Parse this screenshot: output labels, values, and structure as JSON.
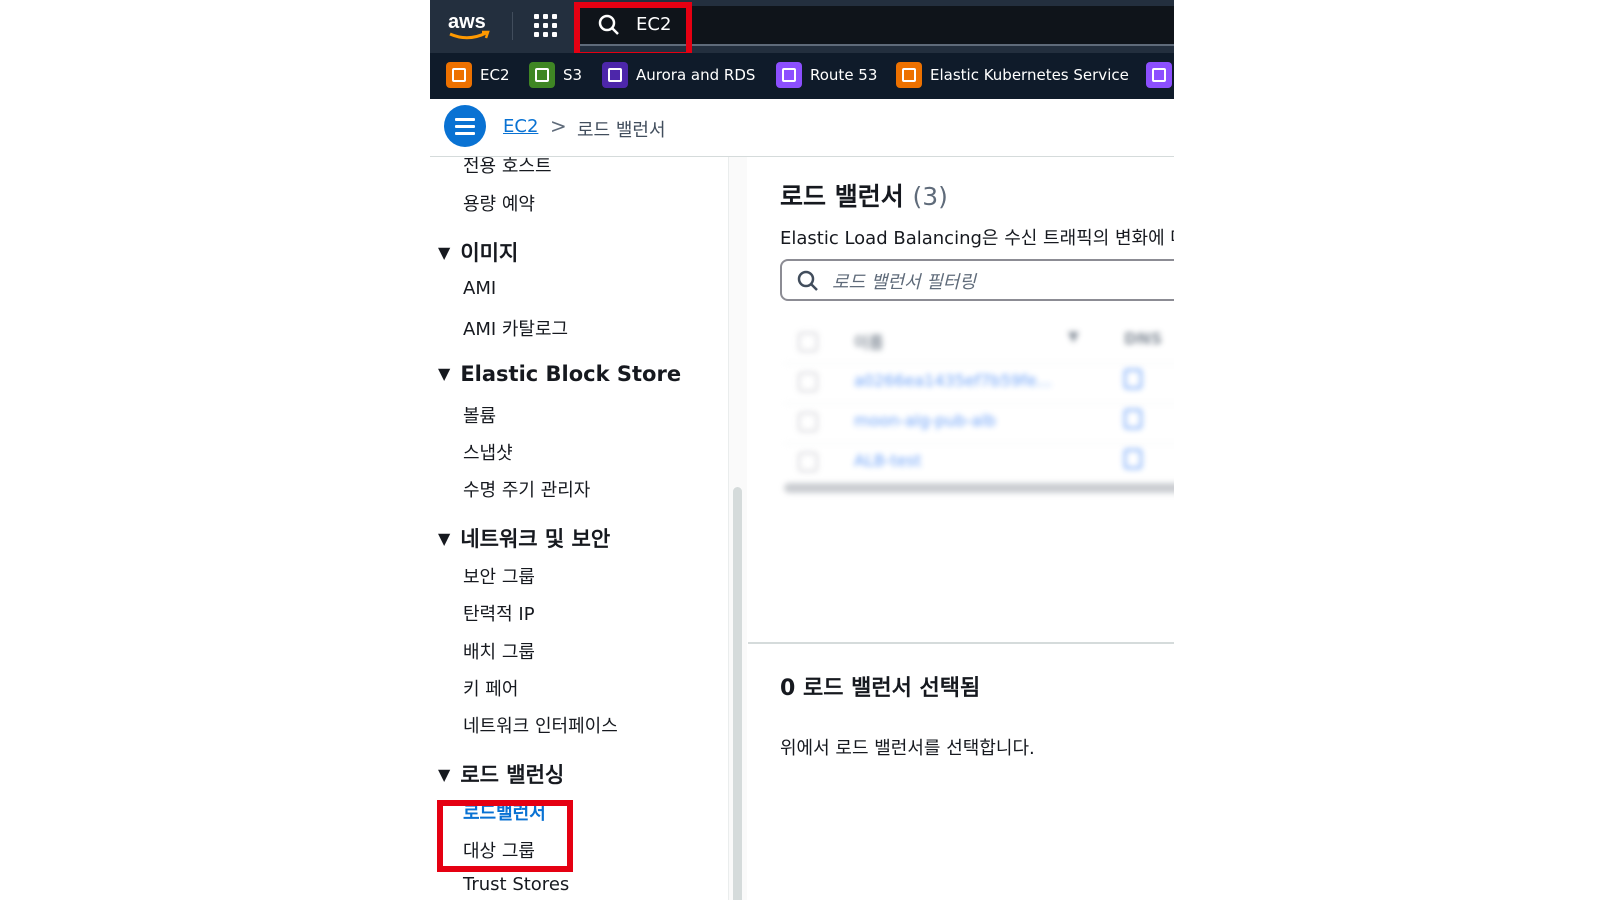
{
  "topbar": {
    "logo_text": "aws",
    "search_value": "EC2",
    "colors": {
      "bar": "#232f3e",
      "highlight": "#e50012"
    }
  },
  "favorites": [
    {
      "label": "EC2",
      "icon": "ec2-icon",
      "color": "#ed7100"
    },
    {
      "label": "S3",
      "icon": "s3-icon",
      "color": "#3f8624"
    },
    {
      "label": "Aurora and RDS",
      "icon": "rds-icon",
      "color": "#4d27aa"
    },
    {
      "label": "Route 53",
      "icon": "route53-icon",
      "color": "#8c4fff"
    },
    {
      "label": "Elastic Kubernetes Service",
      "icon": "eks-icon",
      "color": "#ed7100"
    }
  ],
  "breadcrumb": {
    "root": "EC2",
    "separator": ">",
    "current": "로드 밸런서"
  },
  "sidebar": {
    "items_top": [
      "전용 호스트",
      "용량 예약"
    ],
    "groups": [
      {
        "title": "이미지",
        "items": [
          "AMI",
          "AMI 카탈로그"
        ]
      },
      {
        "title": "Elastic Block Store",
        "items": [
          "볼륨",
          "스냅샷",
          "수명 주기 관리자"
        ]
      },
      {
        "title": "네트워크 및 보안",
        "items": [
          "보안 그룹",
          "탄력적 IP",
          "배치 그룹",
          "키 페어",
          "네트워크 인터페이스"
        ]
      },
      {
        "title": "로드 밸런싱",
        "items": [
          "로드밸런서",
          "대상 그룹",
          "Trust Stores"
        ]
      }
    ],
    "active_item": "로드밸런서"
  },
  "main": {
    "title": "로드 밸런서",
    "count": "(3)",
    "description": "Elastic Load Balancing은 수신 트래픽의 변화에 따",
    "filter_placeholder": "로드 밸런서 필터링",
    "table": {
      "headers": [
        "이름",
        "DNS"
      ],
      "rows": [
        "a0266ea1435ef7b59fe...",
        "moon-alg-pub-alb",
        "ALB-test"
      ]
    },
    "selection_title": "0 로드 밸런서 선택됨",
    "selection_desc": "위에서 로드 밸런서를 선택합니다."
  }
}
